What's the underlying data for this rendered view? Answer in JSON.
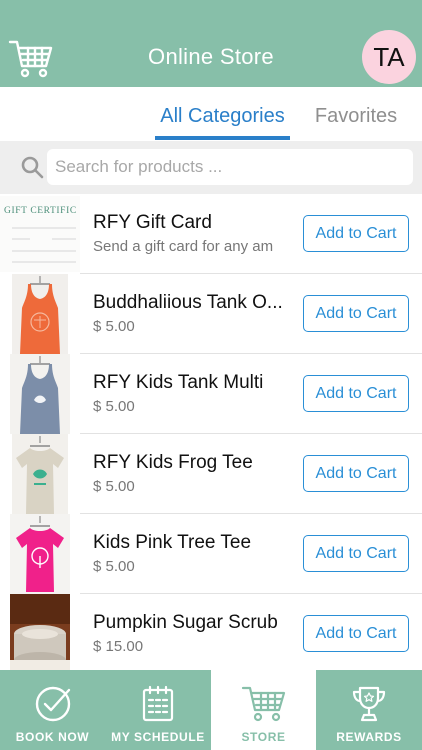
{
  "header": {
    "title": "Online Store",
    "avatar_initials": "TA",
    "cart_icon": "cart-icon"
  },
  "tabs": [
    {
      "label": "All Categories",
      "active": true
    },
    {
      "label": "Favorites",
      "active": false
    }
  ],
  "search": {
    "placeholder": "Search for products ...",
    "value": ""
  },
  "products": [
    {
      "name": "RFY Gift Card",
      "subtitle": "Send a gift card for any am",
      "image": "gift-certificate",
      "thumb_text": "GIFT CERTIFIC",
      "button": "Add to Cart"
    },
    {
      "name": "Buddhaliious Tank O...",
      "subtitle": "$ 5.00",
      "image": "orange-tank-top",
      "button": "Add to Cart"
    },
    {
      "name": "RFY Kids Tank Multi",
      "subtitle": "$ 5.00",
      "image": "blue-tank-top",
      "button": "Add to Cart"
    },
    {
      "name": "RFY Kids Frog Tee",
      "subtitle": "$ 5.00",
      "image": "beige-tee",
      "button": "Add to Cart"
    },
    {
      "name": "Kids Pink Tree Tee",
      "subtitle": "$ 5.00",
      "image": "pink-tee",
      "button": "Add to Cart"
    },
    {
      "name": "Pumpkin Sugar Scrub",
      "subtitle": "$ 15.00",
      "image": "scrub-jar",
      "button": "Add to Cart"
    }
  ],
  "bottom_nav": [
    {
      "label": "BOOK NOW",
      "icon": "check-circle-icon",
      "active": false
    },
    {
      "label": "MY SCHEDULE",
      "icon": "calendar-icon",
      "active": false
    },
    {
      "label": "STORE",
      "icon": "cart-icon",
      "active": true
    },
    {
      "label": "REWARDS",
      "icon": "trophy-icon",
      "active": false
    }
  ],
  "colors": {
    "brand": "#87bfa9",
    "accent": "#2a8fd6",
    "avatar_bg": "#fbd3df"
  }
}
